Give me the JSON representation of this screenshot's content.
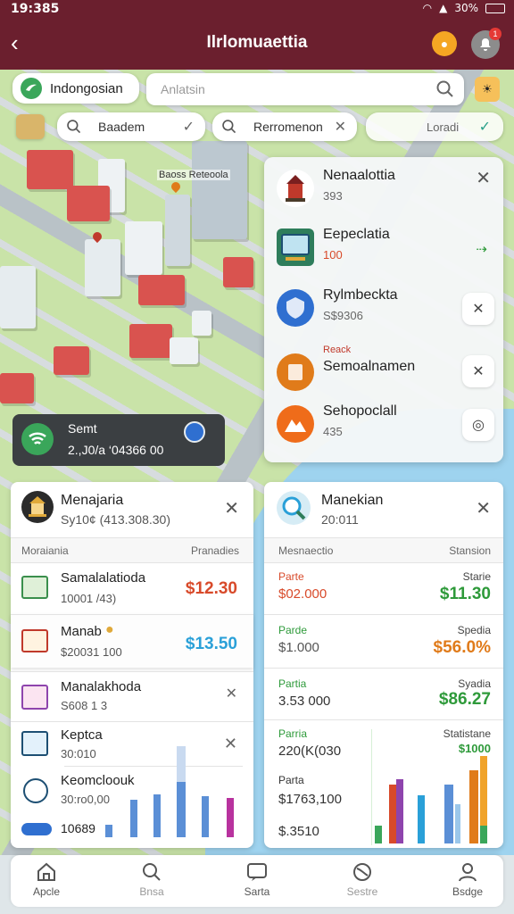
{
  "status": {
    "time": "19:385",
    "battery": "30%"
  },
  "topbar": {
    "title": "Ilrlomuaettia",
    "badge": "1"
  },
  "search": {
    "brand": "Indongosian",
    "placeholder": "Anlatsin",
    "chip1": "Baadem",
    "chip2": "Rerromenon",
    "right_label": "Loradi"
  },
  "map_label": "Baoss Reteoola",
  "poi": [
    {
      "title": "Nenaalottia",
      "sub": "393",
      "icon": "temple-icon",
      "color": "#c0392b"
    },
    {
      "title": "Eepeclatia",
      "sub": "100",
      "icon": "screen-icon",
      "color": "#2e7d5b"
    },
    {
      "title": "Rylmbeckta",
      "sub": "S$9306",
      "icon": "shield-icon",
      "color": "#2f6fd0"
    },
    {
      "title": "Semoalnamen",
      "sub": "Reack",
      "icon": "box-icon",
      "color": "#e07b1a"
    },
    {
      "title": "Sehopoclall",
      "sub": "435",
      "icon": "mountain-icon",
      "color": "#ef6c1a"
    }
  ],
  "snack": {
    "title": "Semt",
    "text": "2.,J0/a ‘04366 00"
  },
  "left_card": {
    "title": "Menajaria",
    "sub": "Sy10¢ (413.308.30)",
    "hdr_left": "Moraiania",
    "hdr_right": "Pranadies",
    "rows": [
      {
        "title": "Samalalatioda",
        "sub": "10001 /43)",
        "amount": "$12.30",
        "color": "#d84a2a"
      },
      {
        "title": "Manab",
        "sub": "$20031 100",
        "amount": "$13.50",
        "color": "#2aa0d8"
      },
      {
        "title": "Manalakhoda",
        "sub": "S608 1 3"
      },
      {
        "title": "Keptca",
        "sub": "30:010"
      },
      {
        "title": "Keomcloouk",
        "sub": "30:ro0,00"
      }
    ],
    "foot": "10689"
  },
  "right_card": {
    "title": "Manekian",
    "sub": "20:011",
    "hdr_left": "Mesnaectio",
    "hdr_right": "Stansion",
    "rows": [
      {
        "label": "Parte",
        "value": "$02.000",
        "rlabel": "Starie",
        "amount": "$11.30",
        "color": "#d84a2a",
        "acolor": "#2e9a3a"
      },
      {
        "label": "Parde",
        "value": "$1.000",
        "rlabel": "Spedia",
        "amount": "$56.0%",
        "color": "#2e9a3a",
        "acolor": "#e07b1a"
      },
      {
        "label": "Partia",
        "value": "3.53 000",
        "rlabel": "Syadia",
        "amount": "$86.27",
        "color": "#2e9a3a",
        "acolor": "#2e9a3a"
      },
      {
        "label": "Parria",
        "value": "220(K(030",
        "rlabel": "Statistane",
        "amount": "$1000",
        "color": "#2e9a3a",
        "acolor": "#2e9a3a"
      }
    ],
    "row5_label": "Parta",
    "row5_value": "$1763,100",
    "foot": "$.3510"
  },
  "nav": [
    {
      "label": "Apcle",
      "icon": "home-icon"
    },
    {
      "label": "Bnsa",
      "icon": "search-icon"
    },
    {
      "label": "Sarta",
      "icon": "chat-icon"
    },
    {
      "label": "Sestre",
      "icon": "globe-icon"
    },
    {
      "label": "Bsdge",
      "icon": "profile-icon"
    }
  ]
}
